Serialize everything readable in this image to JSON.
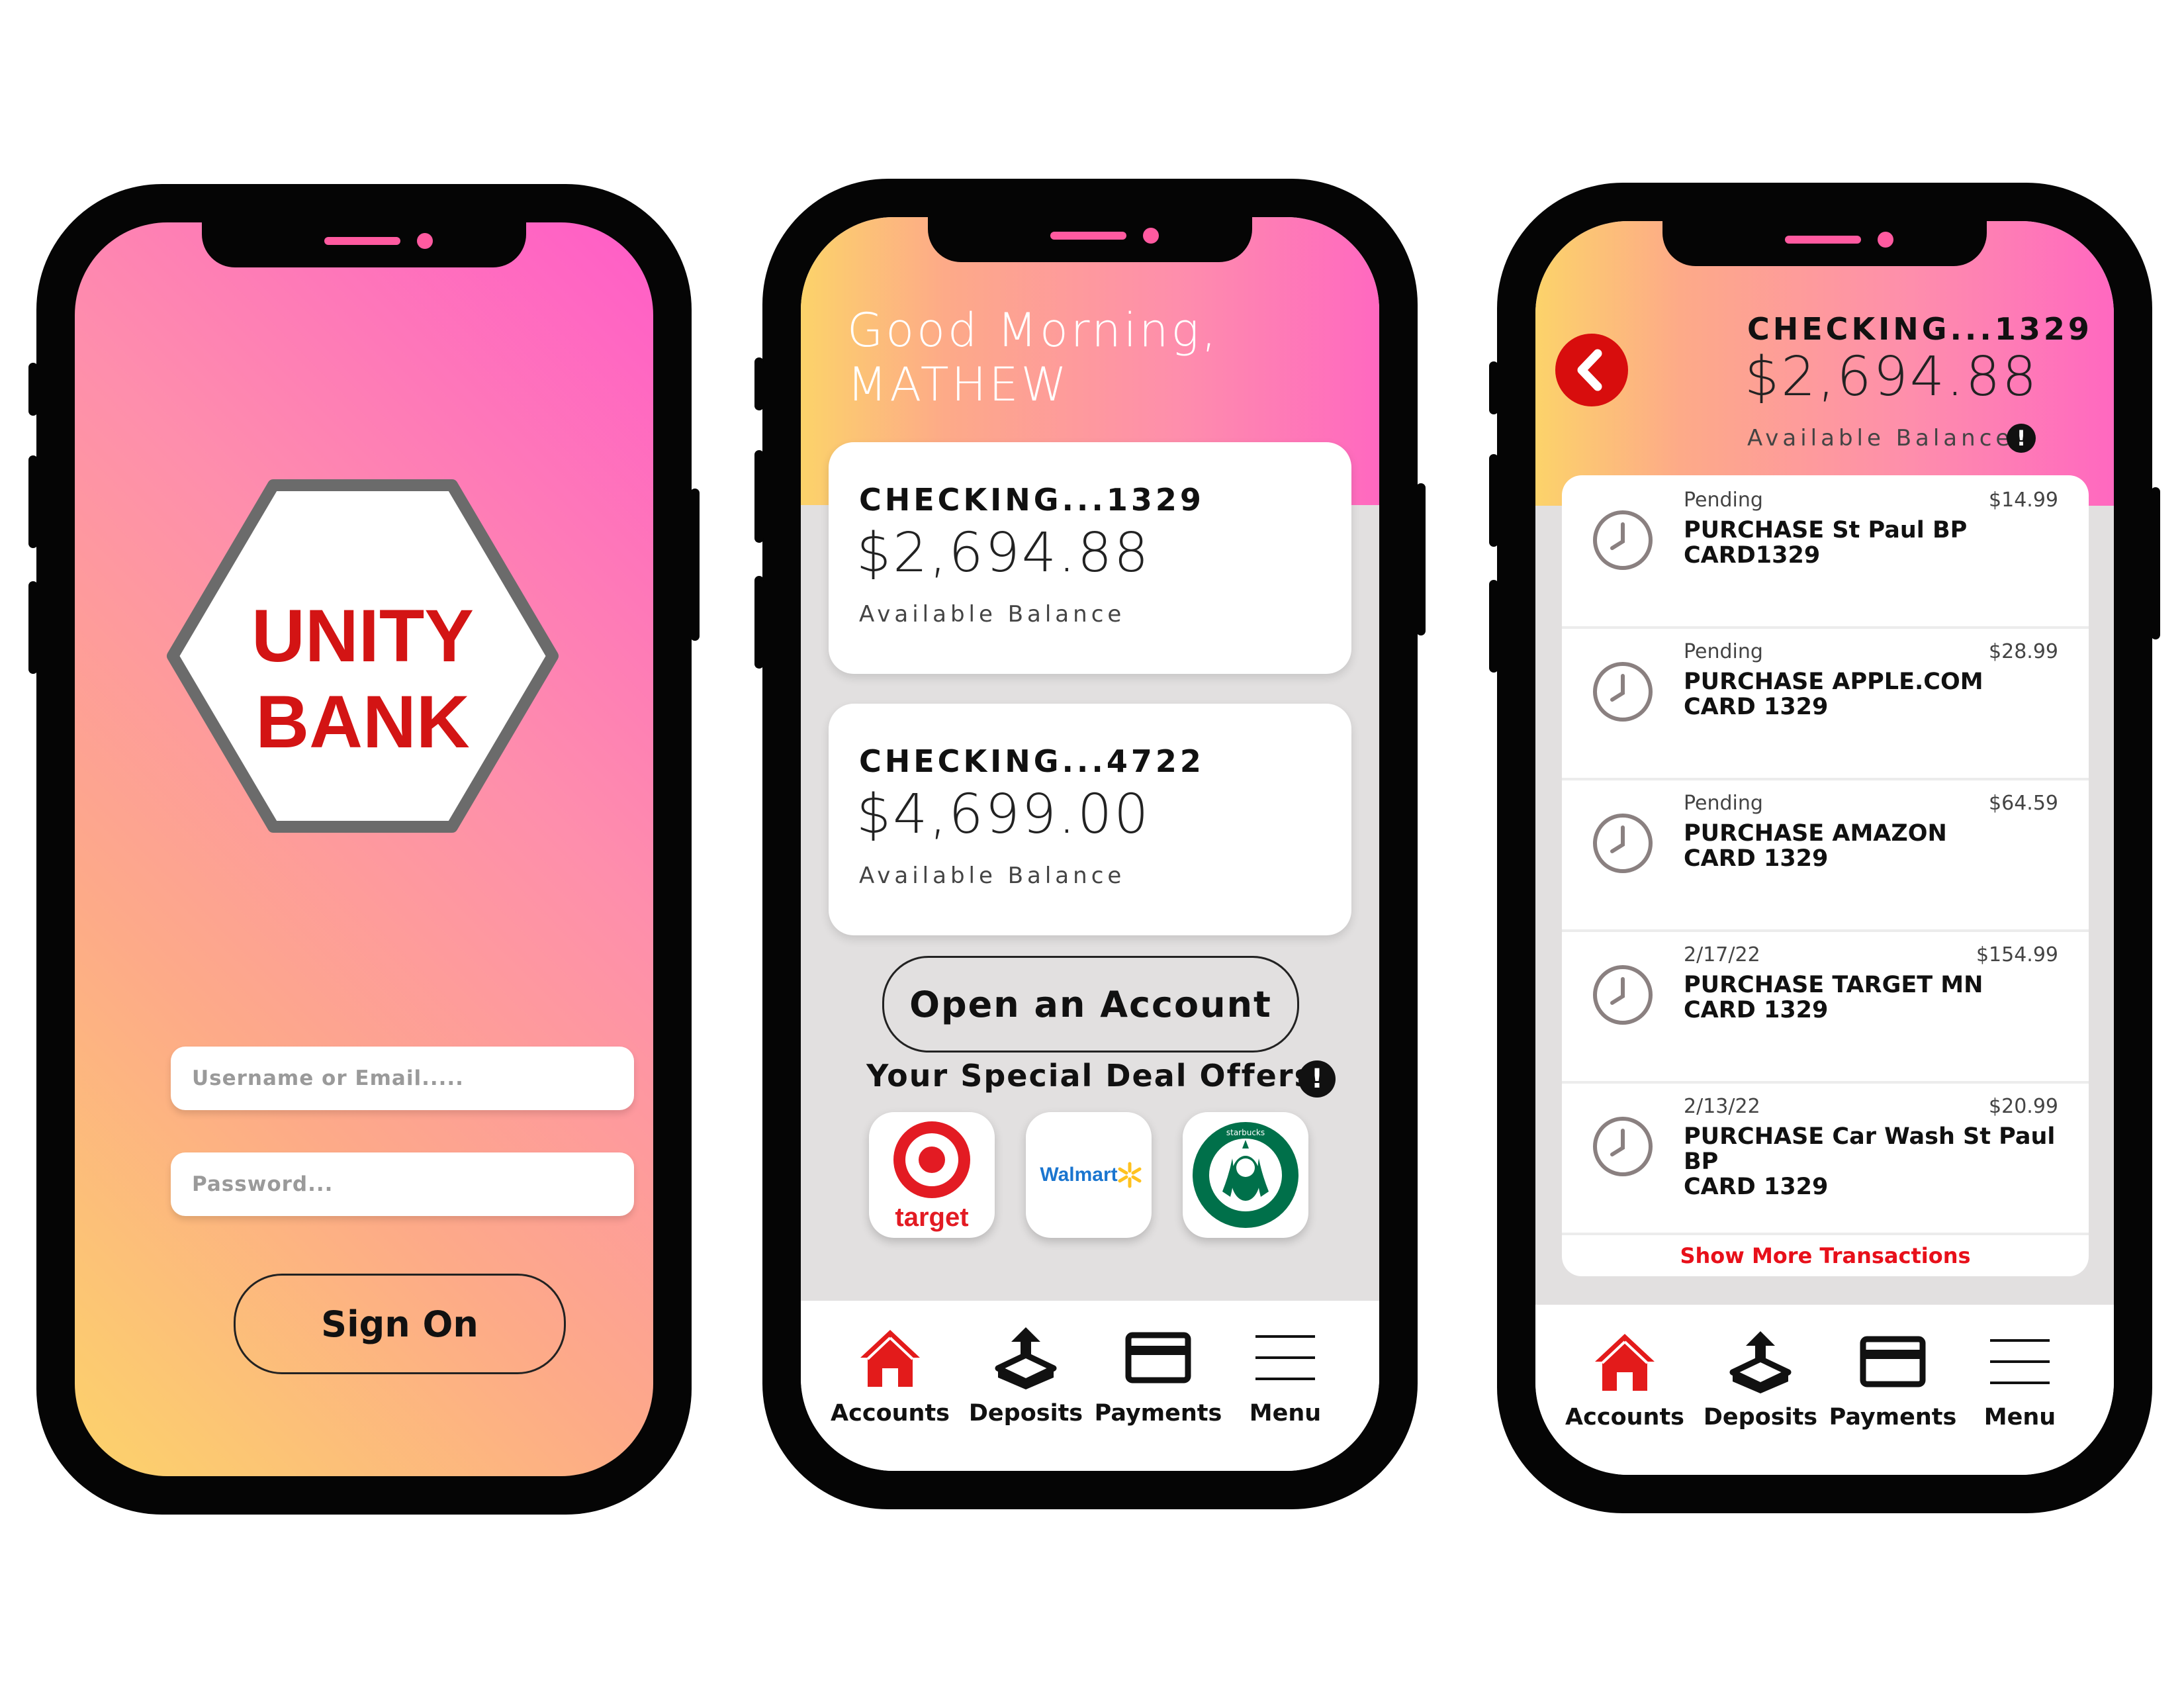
{
  "login": {
    "logo_line1": "UNITY",
    "logo_line2": "BANK",
    "username_placeholder": "Username or Email.....",
    "password_placeholder": "Password...",
    "sign_on": "Sign On"
  },
  "home": {
    "greeting_line1": "Good Morning,",
    "greeting_line2": "MATHEW",
    "accounts": [
      {
        "name": "CHECKING...1329",
        "balance": "$2,694.88",
        "balance_label": "Available Balance"
      },
      {
        "name": "CHECKING...4722",
        "balance": "$4,699.00",
        "balance_label": "Available Balance"
      }
    ],
    "open_account": "Open an Account",
    "offers_title": "Your Special Deal Offers",
    "info_glyph": "!",
    "deals": [
      {
        "brand": "target",
        "icon": "target-logo-icon"
      },
      {
        "brand": "Walmart",
        "icon": "walmart-logo-icon"
      },
      {
        "brand": "starbucks",
        "icon": "starbucks-logo-icon"
      }
    ]
  },
  "account_detail": {
    "name": "CHECKING...1329",
    "balance": "$2,694.88",
    "balance_label": "Available Balance",
    "info_glyph": "!",
    "transactions": [
      {
        "status": "Pending",
        "amount": "$14.99",
        "desc_line1": "PURCHASE St Paul BP",
        "desc_line2": "CARD1329"
      },
      {
        "status": "Pending",
        "amount": "$28.99",
        "desc_line1": "PURCHASE APPLE.COM",
        "desc_line2": "CARD 1329"
      },
      {
        "status": "Pending",
        "amount": "$64.59",
        "desc_line1": "PURCHASE AMAZON",
        "desc_line2": "CARD 1329"
      },
      {
        "status": "2/17/22",
        "amount": "$154.99",
        "desc_line1": "PURCHASE TARGET MN",
        "desc_line2": "CARD 1329"
      },
      {
        "status": "2/13/22",
        "amount": "$20.99",
        "desc_line1": "PURCHASE Car Wash St Paul BP",
        "desc_line2": "CARD 1329"
      }
    ],
    "show_more": "Show More Transactions"
  },
  "nav": {
    "accounts": "Accounts",
    "deposits": "Deposits",
    "payments": "Payments",
    "menu": "Menu"
  },
  "colors": {
    "brand_red": "#d31414",
    "gradient_yellow": "#fcd36a",
    "gradient_pink": "#ff5cc8",
    "panel_gray": "#e2e0e0"
  }
}
